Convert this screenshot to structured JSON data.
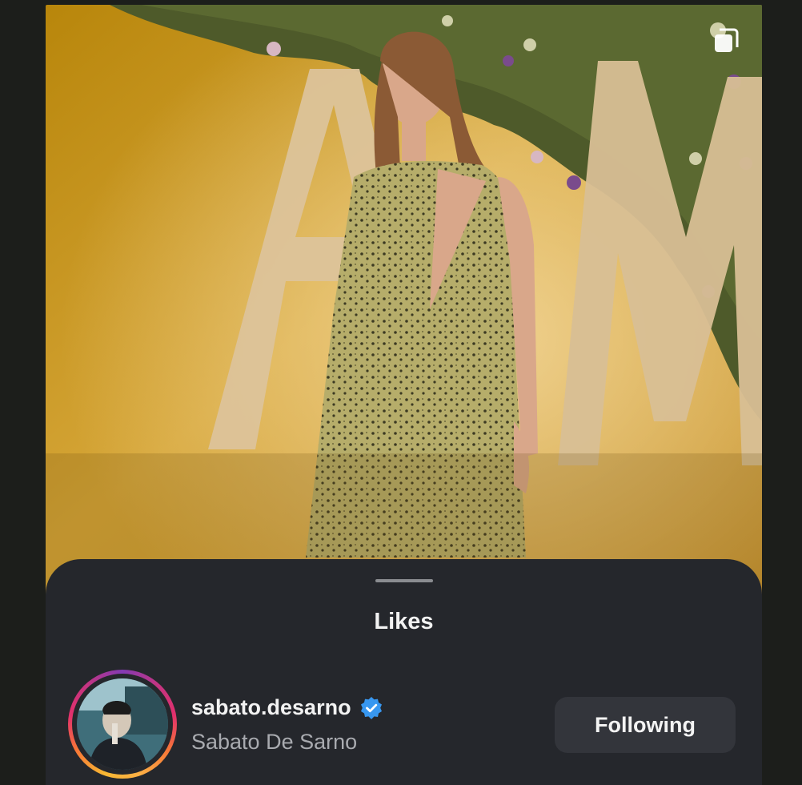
{
  "sheet": {
    "title": "Likes"
  },
  "likes": [
    {
      "username": "sabato.desarno",
      "full_name": "Sabato De Sarno",
      "verified": true,
      "button_label": "Following"
    }
  ],
  "icons": {
    "multi_post": "multiple-photos-icon",
    "verified": "verified-badge-icon"
  },
  "colors": {
    "sheet_bg": "#25272c",
    "button_bg": "#33353b",
    "verified_blue": "#3897f0",
    "text_primary": "#f2f2f2",
    "text_secondary": "#a9abb0"
  }
}
